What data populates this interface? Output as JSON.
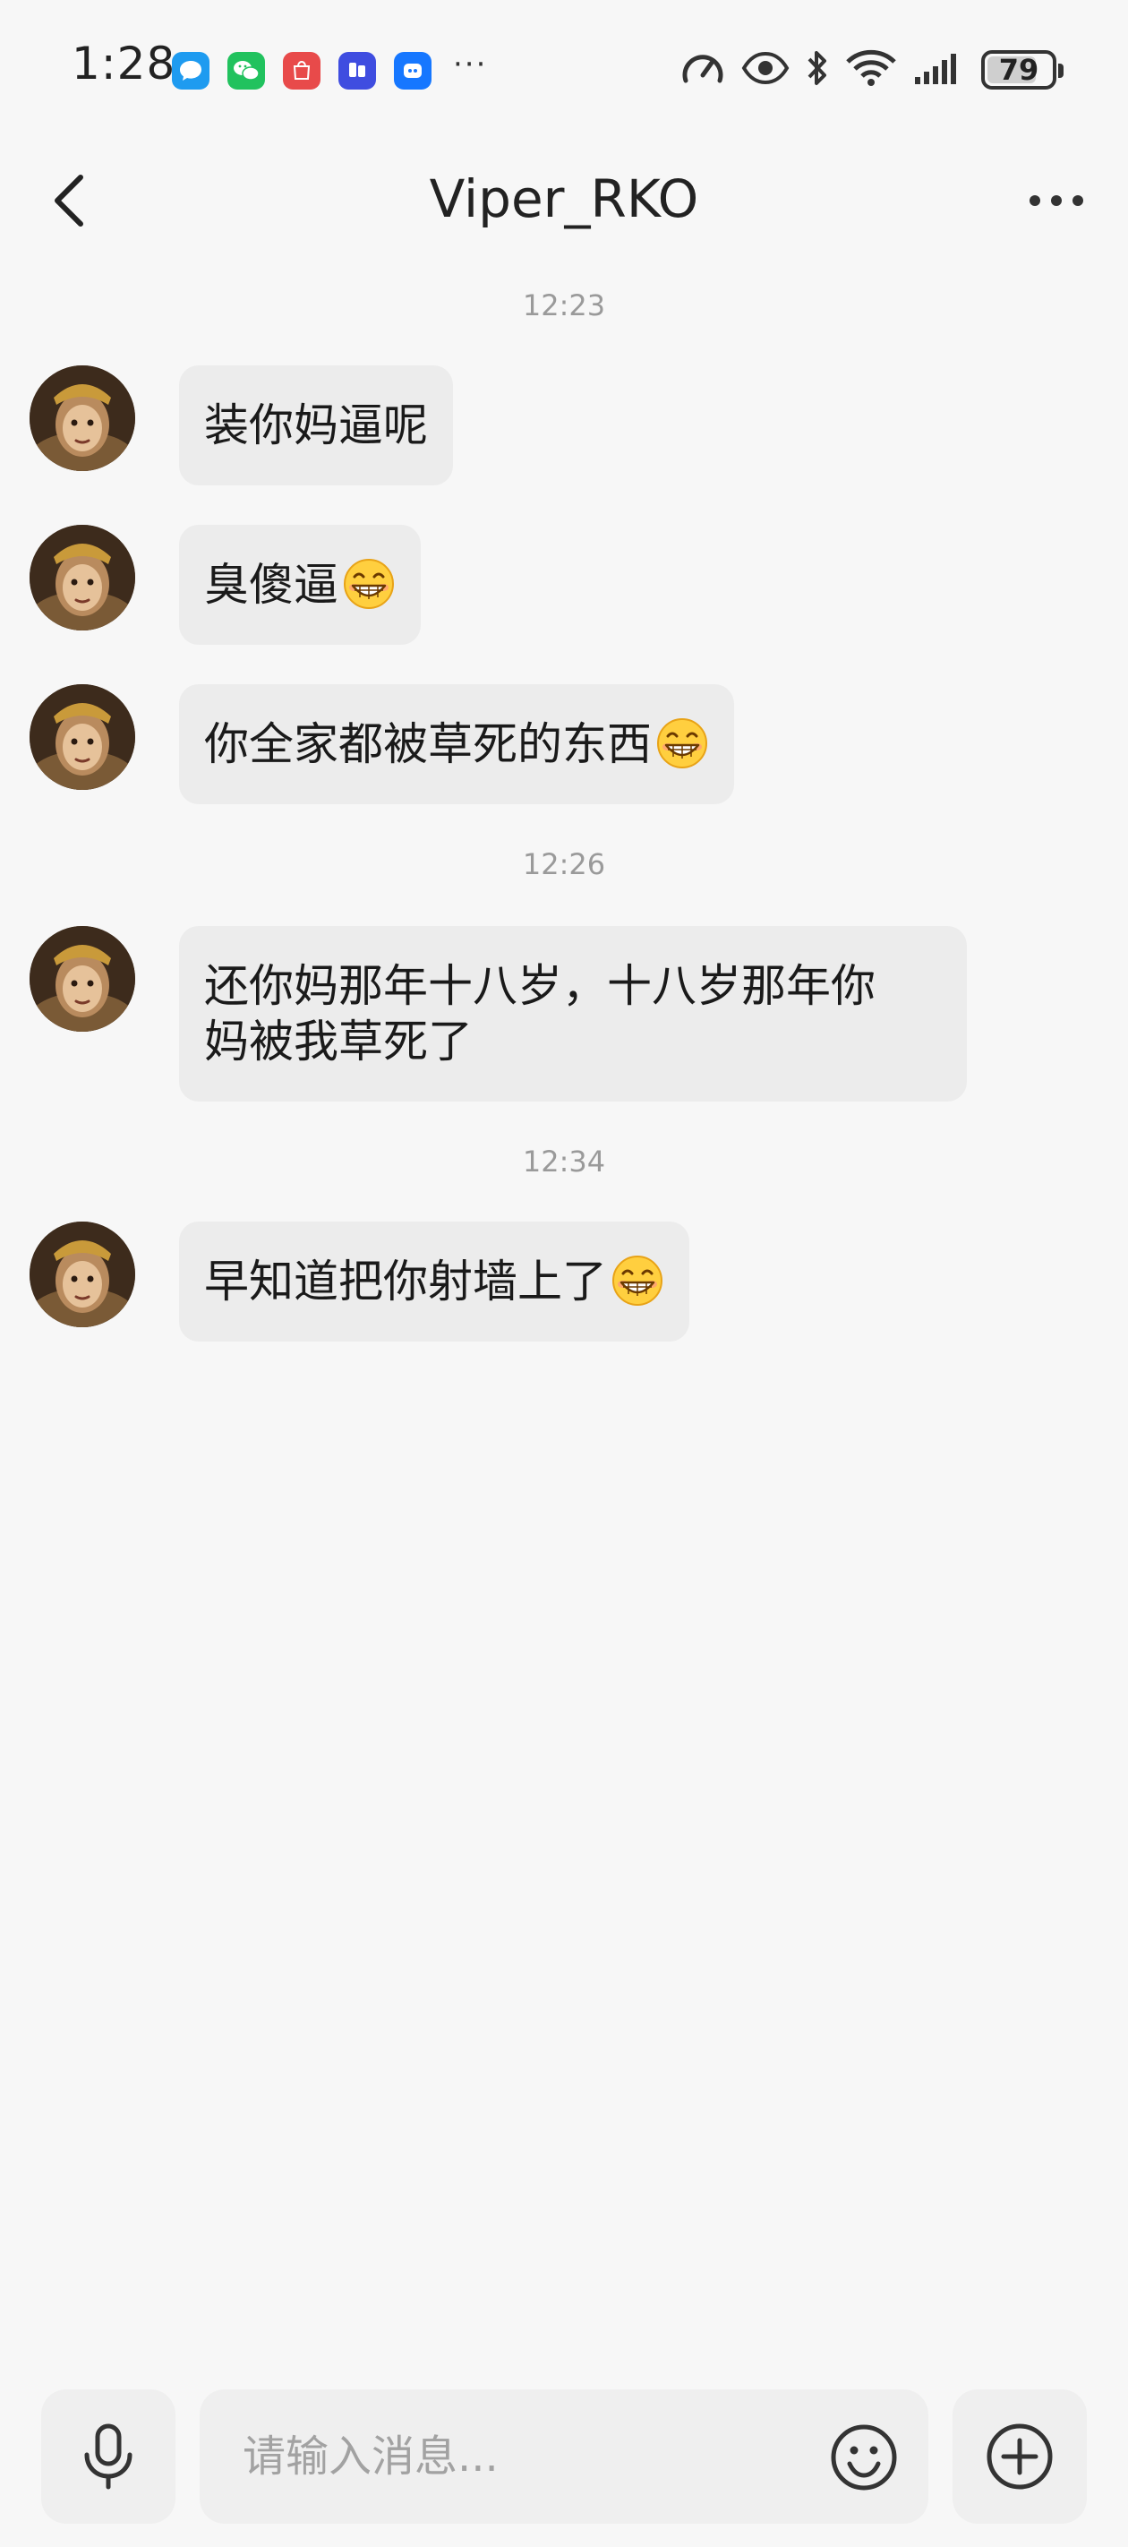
{
  "status_bar": {
    "time": "1:28",
    "battery_level": "79",
    "battery_fraction": 0.79,
    "more_notifications": "···",
    "notification_icons": [
      "messages-icon",
      "wechat-icon",
      "huawei-appgallery-icon",
      "tieba-icon",
      "app-icon"
    ],
    "system_icons": [
      "data-speed-icon",
      "eye-comfort-icon",
      "bluetooth-icon",
      "wifi-icon",
      "signal-icon",
      "battery-icon"
    ]
  },
  "nav": {
    "title": "Viper_RKO",
    "back_icon": "chevron-left-icon",
    "more_icon": "more-horizontal-icon"
  },
  "chat": {
    "groups": [
      {
        "time": "12:23",
        "messages": [
          {
            "text": "装你妈逼呢",
            "emoji": ""
          },
          {
            "text": "臭傻逼",
            "emoji": "grin-emoji"
          },
          {
            "text": "你全家都被草死的东西",
            "emoji": "grin-emoji"
          }
        ]
      },
      {
        "time": "12:26",
        "messages": [
          {
            "text": "还你妈那年十八岁，十八岁那年你\n妈被我草死了",
            "emoji": ""
          }
        ]
      },
      {
        "time": "12:34",
        "messages": [
          {
            "text": "早知道把你射墙上了",
            "emoji": "grin-emoji"
          }
        ]
      }
    ]
  },
  "input_bar": {
    "placeholder": "请输入消息...",
    "voice_icon": "microphone-icon",
    "emoji_icon": "smiley-icon",
    "plus_icon": "plus-circle-icon"
  },
  "colors": {
    "background": "#f7f7f7",
    "bubble": "#ececec",
    "timestamp": "#9a9a9a"
  }
}
